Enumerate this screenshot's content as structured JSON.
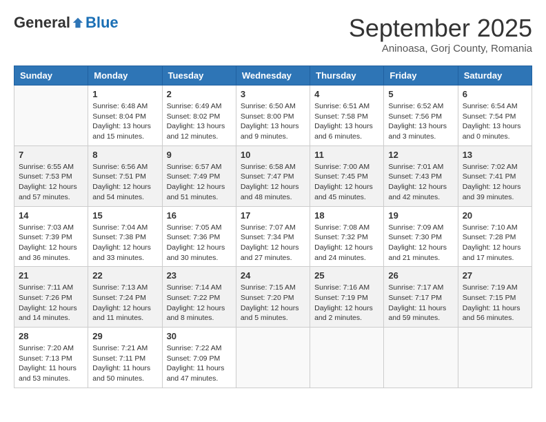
{
  "logo": {
    "general": "General",
    "blue": "Blue"
  },
  "header": {
    "month": "September 2025",
    "location": "Aninoasa, Gorj County, Romania"
  },
  "weekdays": [
    "Sunday",
    "Monday",
    "Tuesday",
    "Wednesday",
    "Thursday",
    "Friday",
    "Saturday"
  ],
  "weeks": [
    [
      {
        "day": "",
        "info": ""
      },
      {
        "day": "1",
        "info": "Sunrise: 6:48 AM\nSunset: 8:04 PM\nDaylight: 13 hours\nand 15 minutes."
      },
      {
        "day": "2",
        "info": "Sunrise: 6:49 AM\nSunset: 8:02 PM\nDaylight: 13 hours\nand 12 minutes."
      },
      {
        "day": "3",
        "info": "Sunrise: 6:50 AM\nSunset: 8:00 PM\nDaylight: 13 hours\nand 9 minutes."
      },
      {
        "day": "4",
        "info": "Sunrise: 6:51 AM\nSunset: 7:58 PM\nDaylight: 13 hours\nand 6 minutes."
      },
      {
        "day": "5",
        "info": "Sunrise: 6:52 AM\nSunset: 7:56 PM\nDaylight: 13 hours\nand 3 minutes."
      },
      {
        "day": "6",
        "info": "Sunrise: 6:54 AM\nSunset: 7:54 PM\nDaylight: 13 hours\nand 0 minutes."
      }
    ],
    [
      {
        "day": "7",
        "info": "Sunrise: 6:55 AM\nSunset: 7:53 PM\nDaylight: 12 hours\nand 57 minutes."
      },
      {
        "day": "8",
        "info": "Sunrise: 6:56 AM\nSunset: 7:51 PM\nDaylight: 12 hours\nand 54 minutes."
      },
      {
        "day": "9",
        "info": "Sunrise: 6:57 AM\nSunset: 7:49 PM\nDaylight: 12 hours\nand 51 minutes."
      },
      {
        "day": "10",
        "info": "Sunrise: 6:58 AM\nSunset: 7:47 PM\nDaylight: 12 hours\nand 48 minutes."
      },
      {
        "day": "11",
        "info": "Sunrise: 7:00 AM\nSunset: 7:45 PM\nDaylight: 12 hours\nand 45 minutes."
      },
      {
        "day": "12",
        "info": "Sunrise: 7:01 AM\nSunset: 7:43 PM\nDaylight: 12 hours\nand 42 minutes."
      },
      {
        "day": "13",
        "info": "Sunrise: 7:02 AM\nSunset: 7:41 PM\nDaylight: 12 hours\nand 39 minutes."
      }
    ],
    [
      {
        "day": "14",
        "info": "Sunrise: 7:03 AM\nSunset: 7:39 PM\nDaylight: 12 hours\nand 36 minutes."
      },
      {
        "day": "15",
        "info": "Sunrise: 7:04 AM\nSunset: 7:38 PM\nDaylight: 12 hours\nand 33 minutes."
      },
      {
        "day": "16",
        "info": "Sunrise: 7:05 AM\nSunset: 7:36 PM\nDaylight: 12 hours\nand 30 minutes."
      },
      {
        "day": "17",
        "info": "Sunrise: 7:07 AM\nSunset: 7:34 PM\nDaylight: 12 hours\nand 27 minutes."
      },
      {
        "day": "18",
        "info": "Sunrise: 7:08 AM\nSunset: 7:32 PM\nDaylight: 12 hours\nand 24 minutes."
      },
      {
        "day": "19",
        "info": "Sunrise: 7:09 AM\nSunset: 7:30 PM\nDaylight: 12 hours\nand 21 minutes."
      },
      {
        "day": "20",
        "info": "Sunrise: 7:10 AM\nSunset: 7:28 PM\nDaylight: 12 hours\nand 17 minutes."
      }
    ],
    [
      {
        "day": "21",
        "info": "Sunrise: 7:11 AM\nSunset: 7:26 PM\nDaylight: 12 hours\nand 14 minutes."
      },
      {
        "day": "22",
        "info": "Sunrise: 7:13 AM\nSunset: 7:24 PM\nDaylight: 12 hours\nand 11 minutes."
      },
      {
        "day": "23",
        "info": "Sunrise: 7:14 AM\nSunset: 7:22 PM\nDaylight: 12 hours\nand 8 minutes."
      },
      {
        "day": "24",
        "info": "Sunrise: 7:15 AM\nSunset: 7:20 PM\nDaylight: 12 hours\nand 5 minutes."
      },
      {
        "day": "25",
        "info": "Sunrise: 7:16 AM\nSunset: 7:19 PM\nDaylight: 12 hours\nand 2 minutes."
      },
      {
        "day": "26",
        "info": "Sunrise: 7:17 AM\nSunset: 7:17 PM\nDaylight: 11 hours\nand 59 minutes."
      },
      {
        "day": "27",
        "info": "Sunrise: 7:19 AM\nSunset: 7:15 PM\nDaylight: 11 hours\nand 56 minutes."
      }
    ],
    [
      {
        "day": "28",
        "info": "Sunrise: 7:20 AM\nSunset: 7:13 PM\nDaylight: 11 hours\nand 53 minutes."
      },
      {
        "day": "29",
        "info": "Sunrise: 7:21 AM\nSunset: 7:11 PM\nDaylight: 11 hours\nand 50 minutes."
      },
      {
        "day": "30",
        "info": "Sunrise: 7:22 AM\nSunset: 7:09 PM\nDaylight: 11 hours\nand 47 minutes."
      },
      {
        "day": "",
        "info": ""
      },
      {
        "day": "",
        "info": ""
      },
      {
        "day": "",
        "info": ""
      },
      {
        "day": "",
        "info": ""
      }
    ]
  ]
}
